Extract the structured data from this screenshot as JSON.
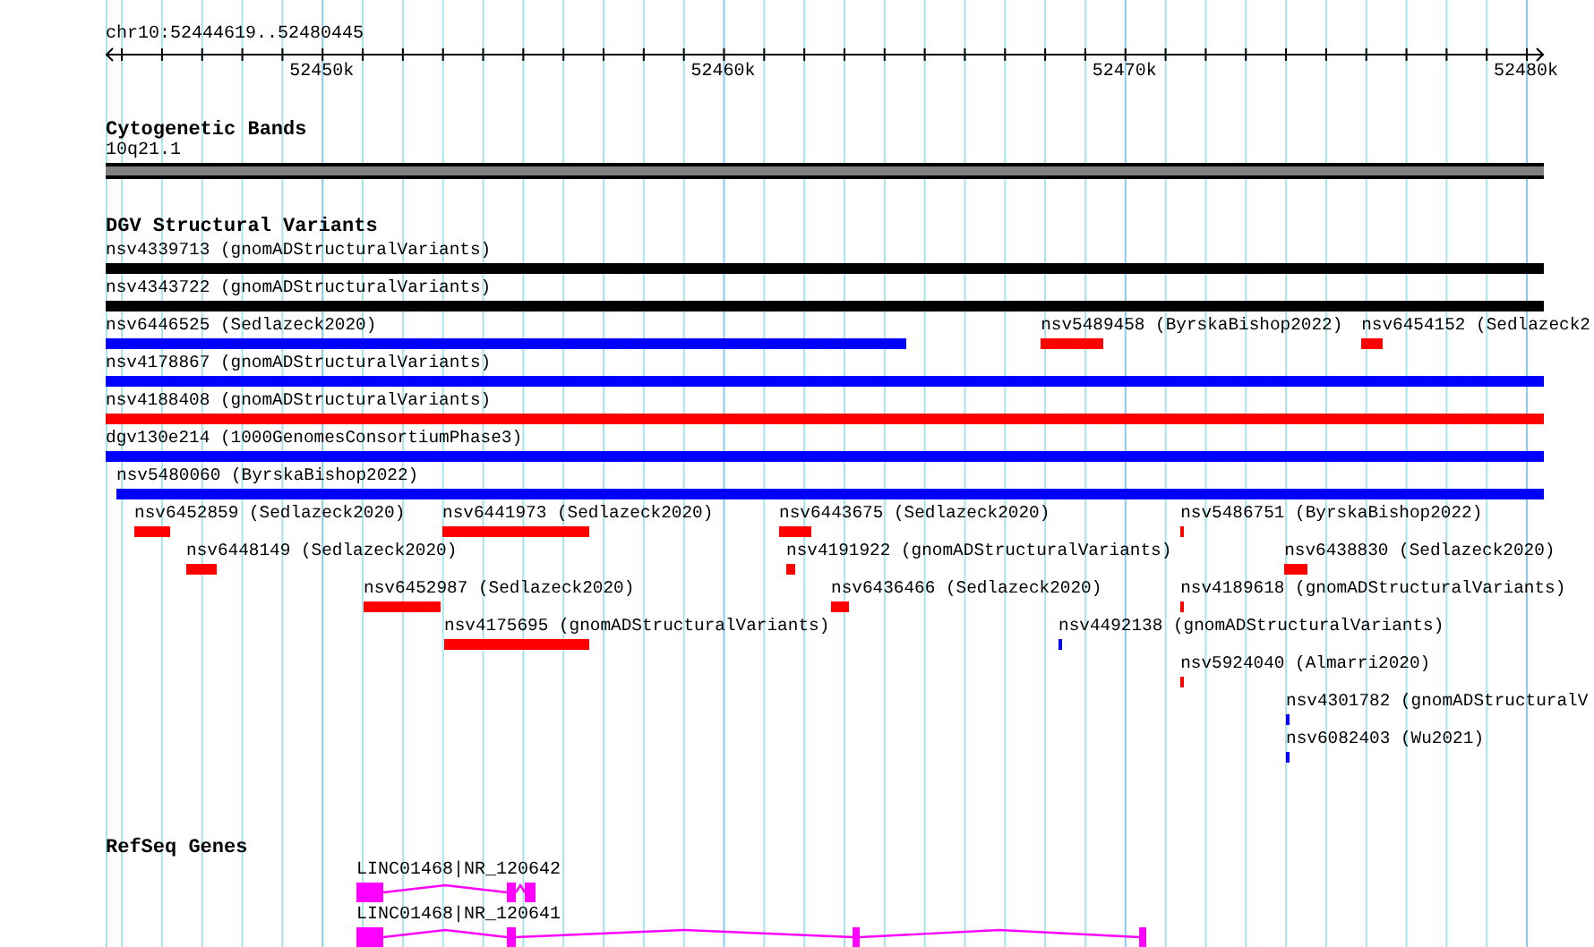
{
  "ruler": {
    "location": "chr10:52444619..52480445",
    "ticks": [
      {
        "label": "52450k"
      },
      {
        "label": "52460k"
      },
      {
        "label": "52470k"
      },
      {
        "label": "52480k"
      }
    ]
  },
  "tracks": [
    {
      "kind": "bands",
      "title": "Cytogenetic Bands",
      "features": [
        {
          "label": "10q21.1"
        }
      ]
    },
    {
      "kind": "variants",
      "title": "DGV Structural Variants",
      "rows": [
        [
          {
            "label": "nsv4339713 (gnomADStructuralVariants)",
            "color": "#000000"
          }
        ],
        [
          {
            "label": "nsv4343722 (gnomADStructuralVariants)",
            "color": "#000000"
          }
        ],
        [
          {
            "label": "nsv6446525 (Sedlazeck2020)",
            "color": "#0000ff"
          },
          {
            "label": "nsv5489458 (ByrskaBishop2022)",
            "color": "#ff0000"
          },
          {
            "label": "nsv6454152 (Sedlazeck2",
            "color": "#ff0000"
          }
        ],
        [
          {
            "label": "nsv4178867 (gnomADStructuralVariants)",
            "color": "#0000ff"
          }
        ],
        [
          {
            "label": "nsv4188408 (gnomADStructuralVariants)",
            "color": "#ff0000"
          }
        ],
        [
          {
            "label": "dgv130e214 (1000GenomesConsortiumPhase3)",
            "color": "#0000ff"
          }
        ],
        [
          {
            "label": "nsv5480060 (ByrskaBishop2022)",
            "color": "#0000ff"
          }
        ],
        [
          {
            "label": "nsv6452859 (Sedlazeck2020)",
            "color": "#ff0000"
          },
          {
            "label": "nsv6441973 (Sedlazeck2020)",
            "color": "#ff0000"
          },
          {
            "label": "nsv6443675 (Sedlazeck2020)",
            "color": "#ff0000"
          },
          {
            "label": "nsv5486751 (ByrskaBishop2022)",
            "color": "#ff0000"
          }
        ],
        [
          {
            "label": "nsv6448149 (Sedlazeck2020)",
            "color": "#ff0000"
          },
          {
            "label": "nsv4191922 (gnomADStructuralVariants)",
            "color": "#ff0000"
          },
          {
            "label": "nsv6438830 (Sedlazeck2020)",
            "color": "#ff0000"
          }
        ],
        [
          {
            "label": "nsv6452987 (Sedlazeck2020)",
            "color": "#ff0000"
          },
          {
            "label": "nsv6436466 (Sedlazeck2020)",
            "color": "#ff0000"
          },
          {
            "label": "nsv4189618 (gnomADStructuralVariants)",
            "color": "#ff0000"
          }
        ],
        [
          {
            "label": "nsv4175695 (gnomADStructuralVariants)",
            "color": "#ff0000"
          },
          {
            "label": "nsv4492138 (gnomADStructuralVariants)",
            "color": "#0000ff"
          }
        ],
        [
          {
            "label": "nsv5924040 (Almarri2020)",
            "color": "#ff0000"
          }
        ],
        [
          {
            "label": "nsv4301782 (gnomADStructuralV",
            "color": "#0000ff"
          }
        ],
        [
          {
            "label": "nsv6082403 (Wu2021)",
            "color": "#0000ff"
          }
        ]
      ]
    },
    {
      "kind": "genes",
      "title": "RefSeq Genes",
      "genes": [
        {
          "label": "LINC01468|NR_120642"
        },
        {
          "label": "LINC01468|NR_120641"
        }
      ]
    }
  ]
}
